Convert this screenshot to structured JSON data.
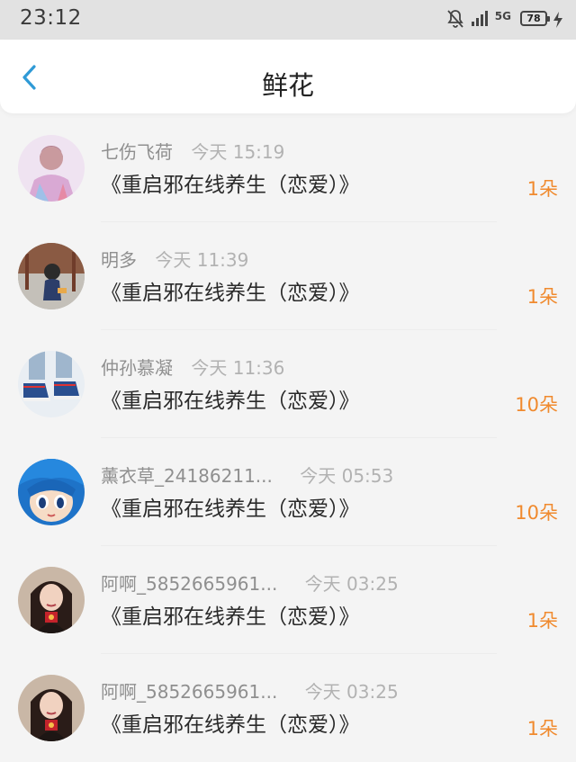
{
  "status_bar": {
    "time": "23:12",
    "battery": "78",
    "network": "5G",
    "icons": [
      "notifications-off-icon",
      "signal-icon",
      "network-5g-icon",
      "battery-icon",
      "charging-icon"
    ]
  },
  "header": {
    "title": "鲜花",
    "back_icon": "chevron-left-icon",
    "accent_color": "#2f9ad6"
  },
  "colors": {
    "flower_count": "#f08a2e",
    "username": "#8f8f8f",
    "timestamp": "#b2b2b2"
  },
  "items": [
    {
      "username": "七伤飞荷",
      "time": "今天 15:19",
      "book": "《重启邪在线养生（恋爱）》",
      "count": "1朵"
    },
    {
      "username": "明多",
      "time": "今天 11:39",
      "book": "《重启邪在线养生（恋爱）》",
      "count": "1朵"
    },
    {
      "username": "仲孙慕凝",
      "time": "今天 11:36",
      "book": "《重启邪在线养生（恋爱）》",
      "count": "10朵"
    },
    {
      "username": "薰衣草_24186211...",
      "time": "今天 05:53",
      "book": "《重启邪在线养生（恋爱）》",
      "count": "10朵"
    },
    {
      "username": "阿啊_5852665961...",
      "time": "今天 03:25",
      "book": "《重启邪在线养生（恋爱）》",
      "count": "1朵"
    },
    {
      "username": "阿啊_5852665961...",
      "time": "今天 03:25",
      "book": "《重启邪在线养生（恋爱）》",
      "count": "1朵"
    }
  ]
}
